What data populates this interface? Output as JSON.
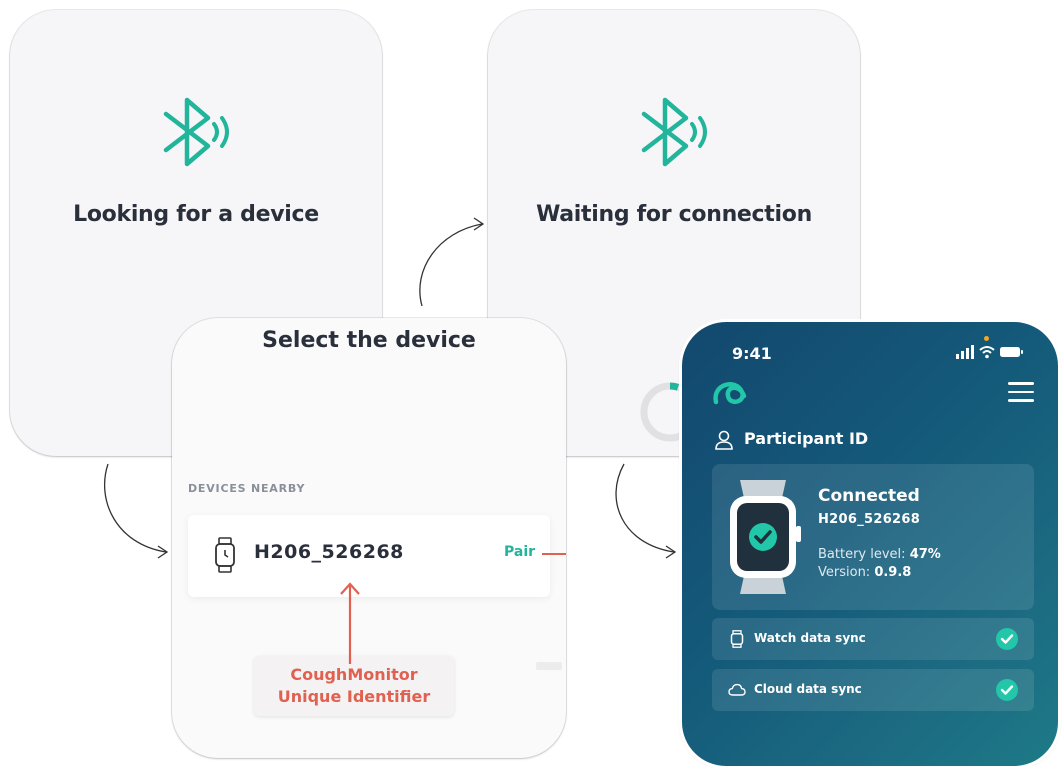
{
  "screens": {
    "looking": {
      "title": "Looking for a device",
      "icon": "bluetooth-icon"
    },
    "waiting": {
      "title": "Waiting for connection",
      "icon": "bluetooth-icon"
    },
    "select": {
      "title": "Select the device",
      "devices_heading": "DEVICES NEARBY",
      "device": {
        "id": "H206_526268",
        "icon": "watch-icon",
        "action_label": "Pair"
      },
      "callout": {
        "line1": "CoughMonitor",
        "line2": "Unique Identifier"
      }
    },
    "phone": {
      "status_time": "9:41",
      "participant_label": "Participant ID",
      "connection": {
        "status": "Connected",
        "device_id": "H206_526268",
        "battery_label": "Battery level: ",
        "battery_value": "47%",
        "version_label": "Version: ",
        "version_value": "0.9.8"
      },
      "sync_items": [
        {
          "label": "Watch data sync",
          "icon": "watch-icon",
          "done": true
        },
        {
          "label": "Cloud data sync",
          "icon": "cloud-icon",
          "done": true
        }
      ]
    }
  },
  "colors": {
    "accent": "#22b59c",
    "highlight": "#e06150",
    "phone_bg": "#145a7a",
    "text_dark": "#2a2f3c"
  }
}
